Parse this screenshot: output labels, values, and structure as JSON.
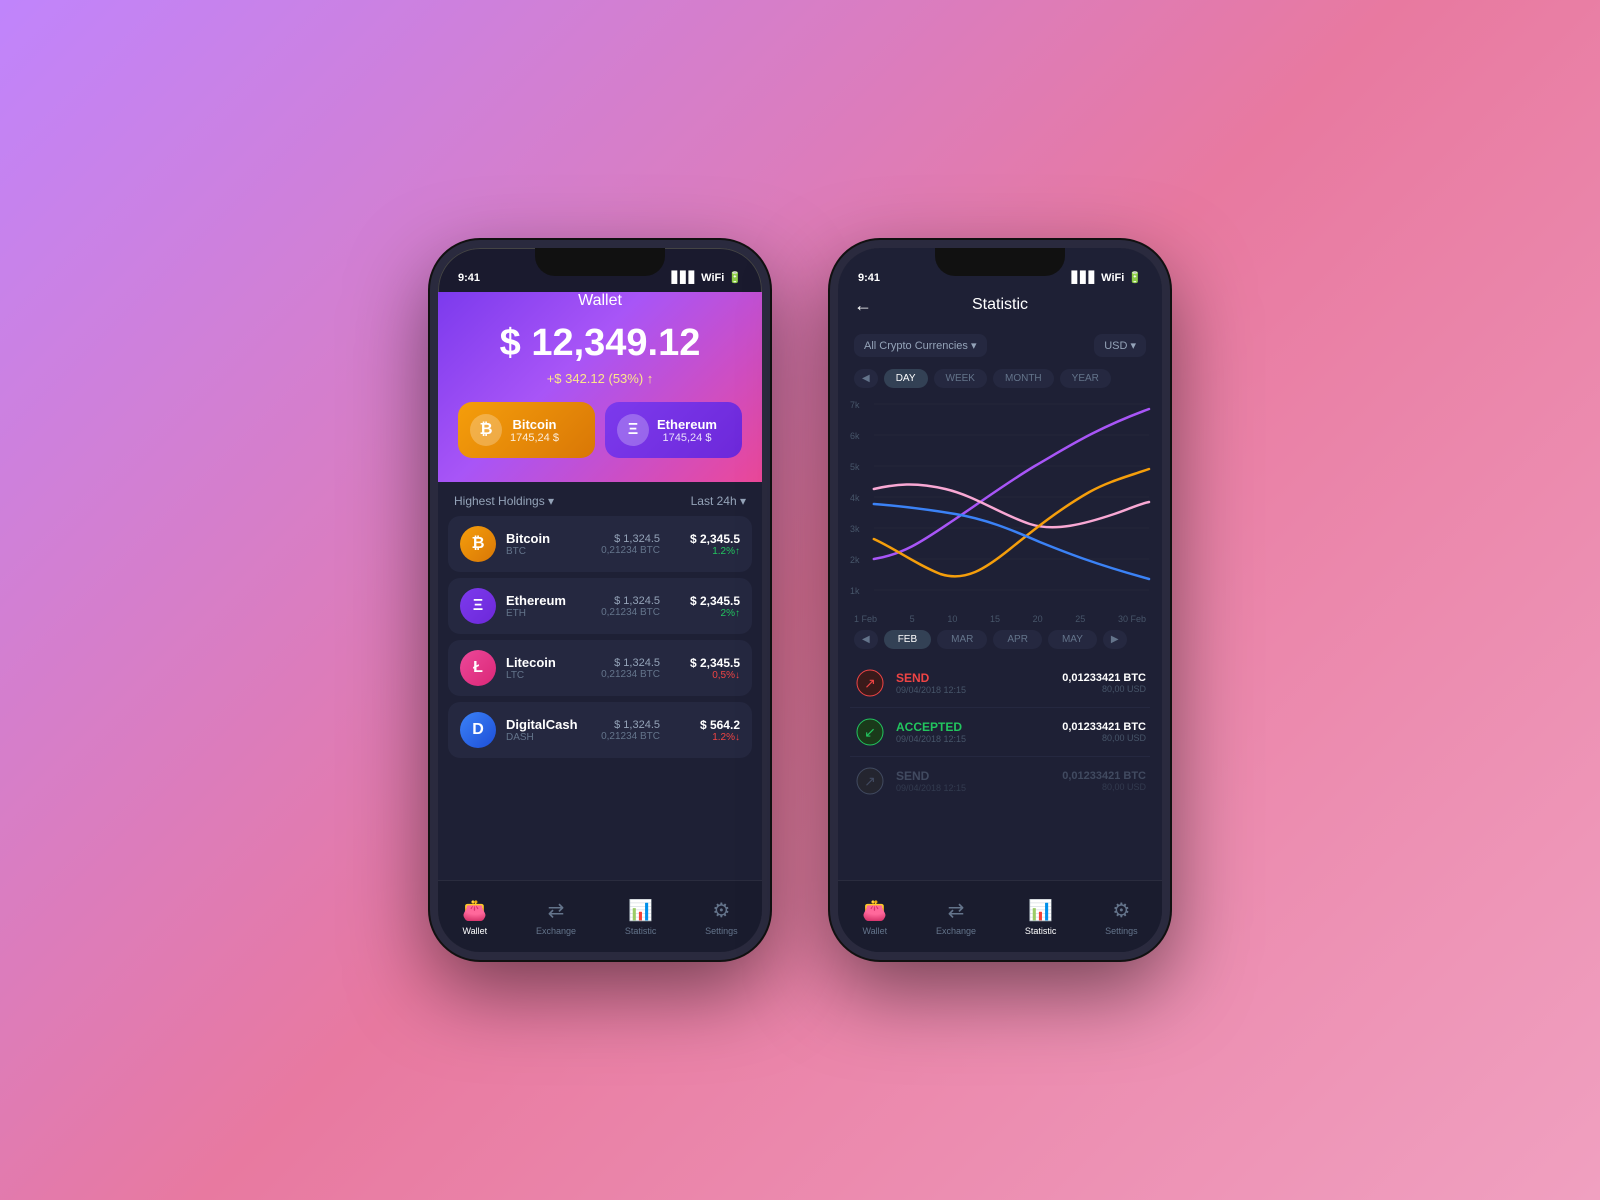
{
  "background": "#c084fc",
  "phone1": {
    "status_time": "9:41",
    "header_title": "Wallet",
    "total_amount": "$ 12,349.12",
    "total_change": "+$ 342.12 (53%) ↑",
    "cards": [
      {
        "name": "Bitcoin",
        "value": "1745,24 $",
        "symbol": "₿",
        "type": "btc"
      },
      {
        "name": "Ethereum",
        "value": "1745,24 $",
        "symbol": "Ξ",
        "type": "eth"
      }
    ],
    "holdings_label": "Highest Holdings ▾",
    "period_label": "Last 24h ▾",
    "coins": [
      {
        "name": "Bitcoin",
        "symbol": "BTC",
        "type": "btc",
        "icon": "₿",
        "price": "$ 1,324.5",
        "btc": "0,21234 BTC",
        "value": "$ 2,345.5",
        "change": "1.2%↑",
        "direction": "up"
      },
      {
        "name": "Ethereum",
        "symbol": "ETH",
        "type": "eth",
        "icon": "Ξ",
        "price": "$ 1,324.5",
        "btc": "0,21234 BTC",
        "value": "$ 2,345.5",
        "change": "2%↑",
        "direction": "up"
      },
      {
        "name": "Litecoin",
        "symbol": "LTC",
        "type": "ltc",
        "icon": "Ł",
        "price": "$ 1,324.5",
        "btc": "0,21234 BTC",
        "value": "$ 2,345.5",
        "change": "0,5%↓",
        "direction": "down"
      },
      {
        "name": "DigitalCash",
        "symbol": "DASH",
        "type": "dash",
        "icon": "D",
        "price": "$ 1,324.5",
        "btc": "0,21234 BTC",
        "value": "$ 564.2",
        "change": "1.2%↓",
        "direction": "down"
      }
    ],
    "nav": [
      {
        "label": "Wallet",
        "icon": "👛",
        "active": true
      },
      {
        "label": "Exchange",
        "icon": "⇄",
        "active": false
      },
      {
        "label": "Statistic",
        "icon": "📊",
        "active": false
      },
      {
        "label": "Settings",
        "icon": "⚙",
        "active": false
      }
    ]
  },
  "phone2": {
    "status_time": "9:41",
    "title": "Statistic",
    "filter_currency": "All Crypto Currencies ▾",
    "filter_usd": "USD ▾",
    "period_tabs": [
      "DAY",
      "WEEK",
      "MONTH",
      "YEAR"
    ],
    "active_period": "DAY",
    "chart_y_labels": [
      "7k",
      "6k",
      "5k",
      "4k",
      "3k",
      "2k",
      "1k"
    ],
    "chart_x_labels": [
      "1 Feb",
      "5",
      "10",
      "15",
      "20",
      "25",
      "30 Feb"
    ],
    "month_tabs": [
      "FEB",
      "MAR",
      "APR",
      "MAY"
    ],
    "active_month": "FEB",
    "transactions": [
      {
        "type": "SEND",
        "date": "09/04/2018 12:15",
        "btc": "0,01233421 BTC",
        "usd": "80,00 USD",
        "direction": "send"
      },
      {
        "type": "ACCEPTED",
        "date": "09/04/2018 12:15",
        "btc": "0,01233421 BTC",
        "usd": "80,00 USD",
        "direction": "accepted"
      },
      {
        "type": "SEND",
        "date": "09/04/2018 12:15",
        "btc": "0,01233421 BTC",
        "usd": "80,00 USD",
        "direction": "send-dim"
      }
    ],
    "nav": [
      {
        "label": "Wallet",
        "icon": "👛",
        "active": false
      },
      {
        "label": "Exchange",
        "icon": "⇄",
        "active": false
      },
      {
        "label": "Statistic",
        "icon": "📊",
        "active": true
      },
      {
        "label": "Settings",
        "icon": "⚙",
        "active": false
      }
    ]
  }
}
